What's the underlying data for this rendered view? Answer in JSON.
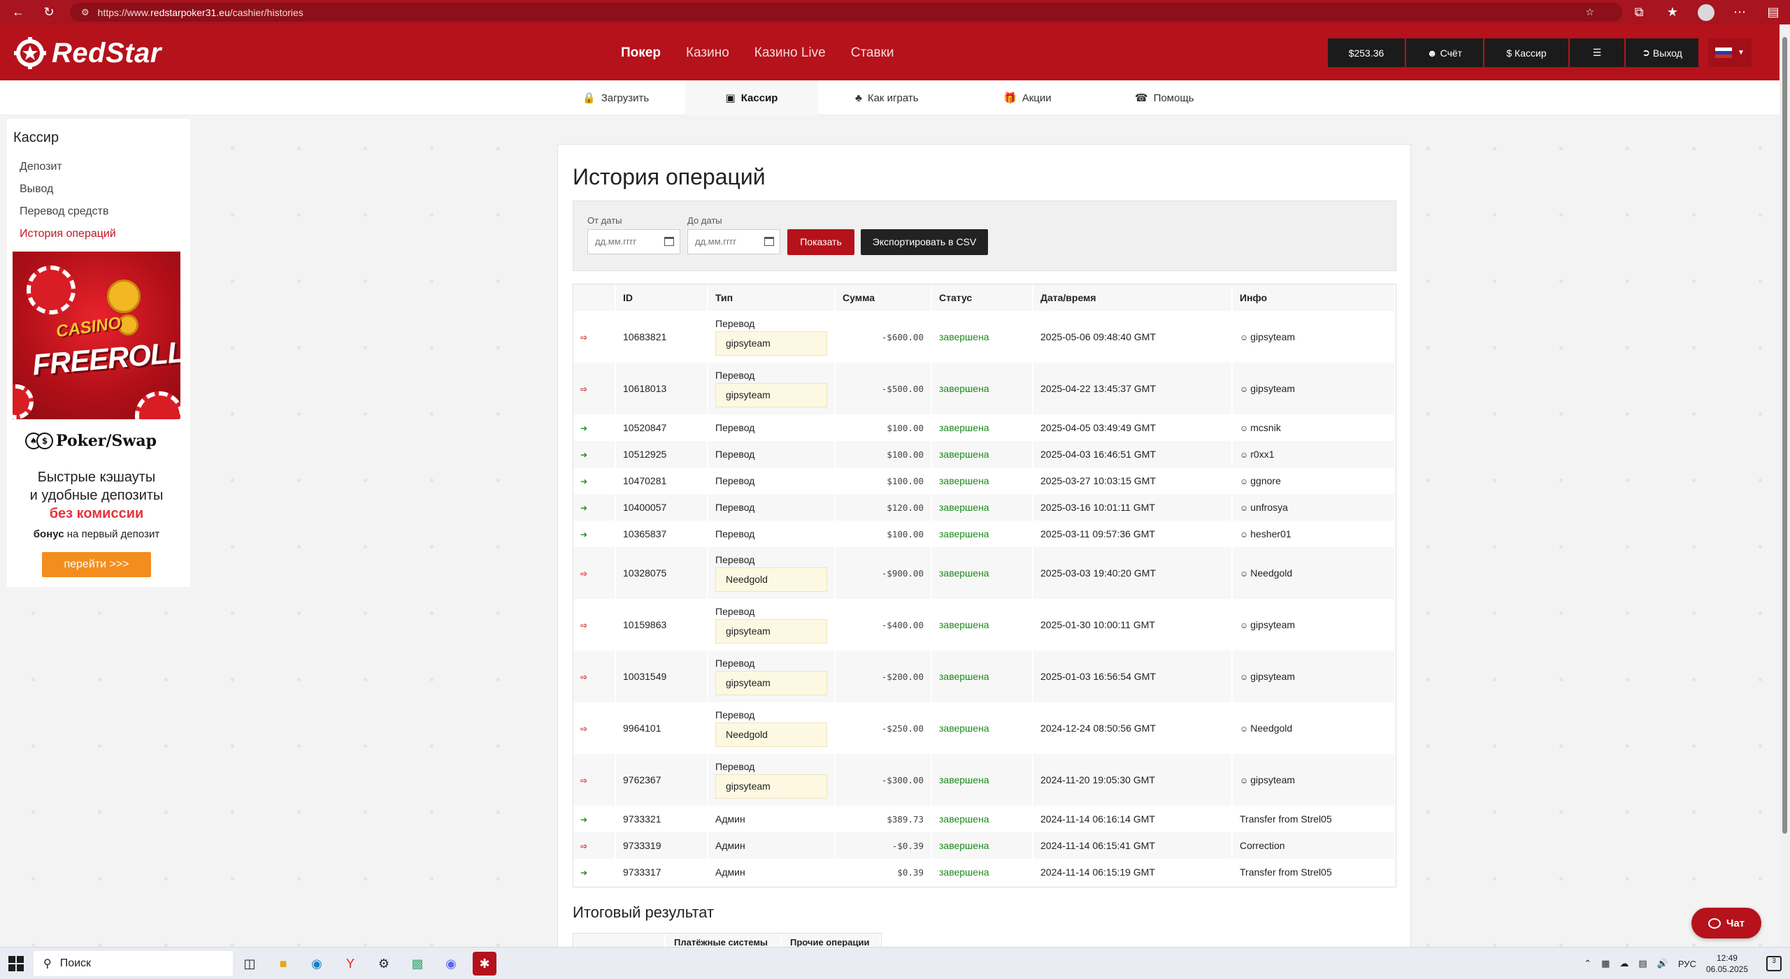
{
  "browser": {
    "url_prefix": "https://www.",
    "url_host": "redstarpoker31.eu",
    "url_path": "/cashier/histories"
  },
  "header": {
    "logo_text": "RedStar",
    "nav": [
      "Покер",
      "Казино",
      "Казино Live",
      "Ставки"
    ],
    "balance": "$253.36",
    "account_label": "Счёт",
    "cashier_label": "$ Кассир",
    "logout_label": "Выход"
  },
  "subnav": [
    "Загрузить",
    "Кассир",
    "Как играть",
    "Акции",
    "Помощь"
  ],
  "sidebar": {
    "title": "Кассир",
    "items": [
      "Депозит",
      "Вывод",
      "Перевод средств",
      "История операций"
    ]
  },
  "banners": {
    "casino_text": "CASINO",
    "freerolls_text": "FREEROLLS",
    "pokerswap_name": "Poker/Swap",
    "line1": "Быстрые кэшауты",
    "line2": "и удобные депозиты",
    "line3": "без комиссии",
    "bonus_bold": "бонус",
    "bonus_rest": " на первый депозит",
    "button": "перейти >>>"
  },
  "page": {
    "title": "История операций",
    "from_label": "От даты",
    "to_label": "До даты",
    "date_placeholder": "дд.мм.гггг",
    "show_button": "Показать",
    "export_button": "Экспортировать в CSV",
    "columns": [
      "ID",
      "Тип",
      "Сумма",
      "Статус",
      "Дата/время",
      "Инфо"
    ],
    "summary_title": "Итоговый результат",
    "summary_columns": [
      "Платёжные системы",
      "Прочие операции"
    ]
  },
  "transactions": [
    {
      "dir": "out",
      "id": "10683821",
      "type": "Перевод",
      "recipient": "gipsyteam",
      "amount": "-$600.00",
      "status": "завершена",
      "datetime": "2025-05-06 09:48:40 GMT",
      "info": "gipsyteam",
      "user": true
    },
    {
      "dir": "out",
      "id": "10618013",
      "type": "Перевод",
      "recipient": "gipsyteam",
      "amount": "-$500.00",
      "status": "завершена",
      "datetime": "2025-04-22 13:45:37 GMT",
      "info": "gipsyteam",
      "user": true
    },
    {
      "dir": "in",
      "id": "10520847",
      "type": "Перевод",
      "recipient": "",
      "amount": "$100.00",
      "status": "завершена",
      "datetime": "2025-04-05 03:49:49 GMT",
      "info": "mcsnik",
      "user": true
    },
    {
      "dir": "in",
      "id": "10512925",
      "type": "Перевод",
      "recipient": "",
      "amount": "$100.00",
      "status": "завершена",
      "datetime": "2025-04-03 16:46:51 GMT",
      "info": "r0xx1",
      "user": true
    },
    {
      "dir": "in",
      "id": "10470281",
      "type": "Перевод",
      "recipient": "",
      "amount": "$100.00",
      "status": "завершена",
      "datetime": "2025-03-27 10:03:15 GMT",
      "info": "ggnore",
      "user": true
    },
    {
      "dir": "in",
      "id": "10400057",
      "type": "Перевод",
      "recipient": "",
      "amount": "$120.00",
      "status": "завершена",
      "datetime": "2025-03-16 10:01:11 GMT",
      "info": "unfrosya",
      "user": true
    },
    {
      "dir": "in",
      "id": "10365837",
      "type": "Перевод",
      "recipient": "",
      "amount": "$100.00",
      "status": "завершена",
      "datetime": "2025-03-11 09:57:36 GMT",
      "info": "hesher01",
      "user": true
    },
    {
      "dir": "out",
      "id": "10328075",
      "type": "Перевод",
      "recipient": "Needgold",
      "amount": "-$900.00",
      "status": "завершена",
      "datetime": "2025-03-03 19:40:20 GMT",
      "info": "Needgold",
      "user": true
    },
    {
      "dir": "out",
      "id": "10159863",
      "type": "Перевод",
      "recipient": "gipsyteam",
      "amount": "-$400.00",
      "status": "завершена",
      "datetime": "2025-01-30 10:00:11 GMT",
      "info": "gipsyteam",
      "user": true
    },
    {
      "dir": "out",
      "id": "10031549",
      "type": "Перевод",
      "recipient": "gipsyteam",
      "amount": "-$200.00",
      "status": "завершена",
      "datetime": "2025-01-03 16:56:54 GMT",
      "info": "gipsyteam",
      "user": true
    },
    {
      "dir": "out",
      "id": "9964101",
      "type": "Перевод",
      "recipient": "Needgold",
      "amount": "-$250.00",
      "status": "завершена",
      "datetime": "2024-12-24 08:50:56 GMT",
      "info": "Needgold",
      "user": true
    },
    {
      "dir": "out",
      "id": "9762367",
      "type": "Перевод",
      "recipient": "gipsyteam",
      "amount": "-$300.00",
      "status": "завершена",
      "datetime": "2024-11-20 19:05:30 GMT",
      "info": "gipsyteam",
      "user": true
    },
    {
      "dir": "in",
      "id": "9733321",
      "type": "Админ",
      "recipient": "",
      "amount": "$389.73",
      "status": "завершена",
      "datetime": "2024-11-14 06:16:14 GMT",
      "info": "Transfer from Strel05",
      "user": false
    },
    {
      "dir": "out",
      "id": "9733319",
      "type": "Админ",
      "recipient": "",
      "amount": "-$0.39",
      "status": "завершена",
      "datetime": "2024-11-14 06:15:41 GMT",
      "info": "Correction",
      "user": false
    },
    {
      "dir": "in",
      "id": "9733317",
      "type": "Админ",
      "recipient": "",
      "amount": "$0.39",
      "status": "завершена",
      "datetime": "2024-11-14 06:15:19 GMT",
      "info": "Transfer from Strel05",
      "user": false
    }
  ],
  "chat": {
    "label": "Чат"
  },
  "taskbar": {
    "search_label": "Поиск",
    "lang": "РУС",
    "time": "12:49",
    "date": "06.05.2025",
    "notif_count": "3"
  },
  "colors": {
    "brand": "#b5121b",
    "status_ok": "#1a8a1a",
    "out_icon": "#d01820"
  }
}
